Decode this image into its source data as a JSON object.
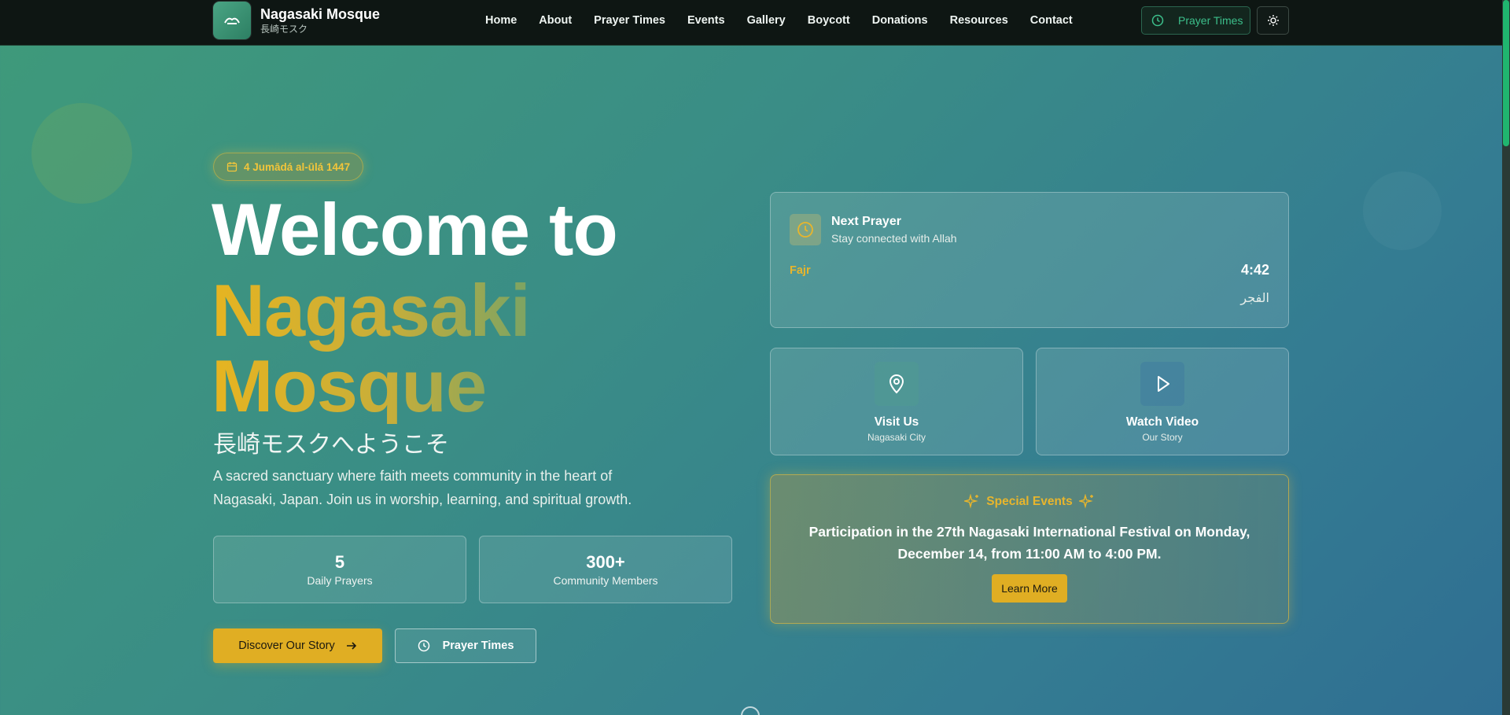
{
  "brand": {
    "name": "Nagasaki Mosque",
    "subtitle": "長崎モスク"
  },
  "nav": {
    "items": [
      {
        "label": "Home"
      },
      {
        "label": "About"
      },
      {
        "label": "Prayer Times"
      },
      {
        "label": "Events"
      },
      {
        "label": "Gallery"
      },
      {
        "label": "Boycott"
      },
      {
        "label": "Donations"
      },
      {
        "label": "Resources"
      },
      {
        "label": "Contact"
      }
    ],
    "prayer_button": "Prayer Times"
  },
  "hero": {
    "hijri_date": "4 Jumādá al-ūlá 1447",
    "welcome": "Welcome to",
    "name_line1": "Nagasaki",
    "name_line2": "Mosque",
    "japanese": "長崎モスクへようこそ",
    "description": "A sacred sanctuary where faith meets community in the heart of Nagasaki, Japan. Join us in worship, learning, and spiritual growth.",
    "stats": [
      {
        "value": "5",
        "label": "Daily Prayers"
      },
      {
        "value": "300+",
        "label": "Community Members"
      }
    ],
    "discover_button": "Discover Our Story",
    "prayer_button": "Prayer Times"
  },
  "next_prayer": {
    "title": "Next Prayer",
    "subtitle": "Stay connected with Allah",
    "name": "Fajr",
    "time": "4:42",
    "arabic": "الفجر"
  },
  "quick_cards": [
    {
      "title": "Visit Us",
      "subtitle": "Nagasaki City",
      "icon": "map-pin-icon"
    },
    {
      "title": "Watch Video",
      "subtitle": "Our Story",
      "icon": "play-icon"
    }
  ],
  "special_events": {
    "heading": "Special Events",
    "text": "Participation in the 27th Nagasaki International Festival on Monday, December 14, from 11:00 AM to 4:00 PM.",
    "button": "Learn More"
  },
  "colors": {
    "accent_gold": "#e0ae23",
    "nav_bg": "#0e1613",
    "accent_green": "#3cbf8b"
  }
}
